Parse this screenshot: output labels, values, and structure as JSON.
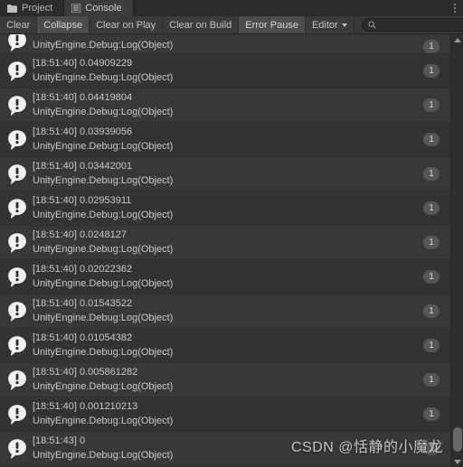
{
  "window": {
    "tabs": [
      {
        "label": "Project",
        "icon": "folder-icon",
        "active": false
      },
      {
        "label": "Console",
        "icon": "console-list-icon",
        "active": true
      }
    ],
    "menu_icon": "kebab-menu-icon"
  },
  "toolbar": {
    "clear_label": "Clear",
    "collapse_label": "Collapse",
    "clear_on_play_label": "Clear on Play",
    "clear_on_build_label": "Clear on Build",
    "error_pause_label": "Error Pause",
    "editor_label": "Editor",
    "search_value": "",
    "search_placeholder": "",
    "search_icon": "search-icon",
    "dropdown_icon": "chevron-down-icon"
  },
  "console": {
    "entries": [
      {
        "message": "",
        "stack": "UnityEngine.Debug:Log(Object)",
        "count": "1",
        "icon": "log-info-icon",
        "clipped": true
      },
      {
        "message": "[18:51:40] 0.04909229",
        "stack": "UnityEngine.Debug:Log(Object)",
        "count": "1",
        "icon": "log-info-icon"
      },
      {
        "message": "[18:51:40] 0.04419804",
        "stack": "UnityEngine.Debug:Log(Object)",
        "count": "1",
        "icon": "log-info-icon"
      },
      {
        "message": "[18:51:40] 0.03939056",
        "stack": "UnityEngine.Debug:Log(Object)",
        "count": "1",
        "icon": "log-info-icon"
      },
      {
        "message": "[18:51:40] 0.03442001",
        "stack": "UnityEngine.Debug:Log(Object)",
        "count": "1",
        "icon": "log-info-icon"
      },
      {
        "message": "[18:51:40] 0.02953911",
        "stack": "UnityEngine.Debug:Log(Object)",
        "count": "1",
        "icon": "log-info-icon"
      },
      {
        "message": "[18:51:40] 0.0248127",
        "stack": "UnityEngine.Debug:Log(Object)",
        "count": "1",
        "icon": "log-info-icon"
      },
      {
        "message": "[18:51:40] 0.02022362",
        "stack": "UnityEngine.Debug:Log(Object)",
        "count": "1",
        "icon": "log-info-icon"
      },
      {
        "message": "[18:51:40] 0.01543522",
        "stack": "UnityEngine.Debug:Log(Object)",
        "count": "1",
        "icon": "log-info-icon"
      },
      {
        "message": "[18:51:40] 0.01054382",
        "stack": "UnityEngine.Debug:Log(Object)",
        "count": "1",
        "icon": "log-info-icon"
      },
      {
        "message": "[18:51:40] 0.005861282",
        "stack": "UnityEngine.Debug:Log(Object)",
        "count": "1",
        "icon": "log-info-icon"
      },
      {
        "message": "[18:51:40] 0.001210213",
        "stack": "UnityEngine.Debug:Log(Object)",
        "count": "1",
        "icon": "log-info-icon"
      },
      {
        "message": "[18:51:43] 0",
        "stack": "UnityEngine.Debug:Log(Object)",
        "count": "1",
        "icon": "log-info-icon"
      }
    ]
  },
  "scrollbar": {
    "up_icon": "scroll-up-arrow-icon",
    "down_icon": "scroll-down-arrow-icon",
    "thumb_top_pct": 93,
    "thumb_height_pct": 6
  },
  "watermark": {
    "text": "CSDN @恬静的小魔龙"
  },
  "colors": {
    "window_bg": "#393939",
    "tabbar_bg": "#2b2b2b",
    "tab_active_bg": "#3c3c3c",
    "button_bg": "#3b3b3b",
    "button_active_bg": "#4c4c4c",
    "row_bg": "#383838",
    "row_alt_bg": "#333333",
    "text": "#c9c9c9",
    "badge_bg": "#565656",
    "scrollbar_track": "#2e2e2e",
    "scrollbar_thumb": "#686868"
  }
}
